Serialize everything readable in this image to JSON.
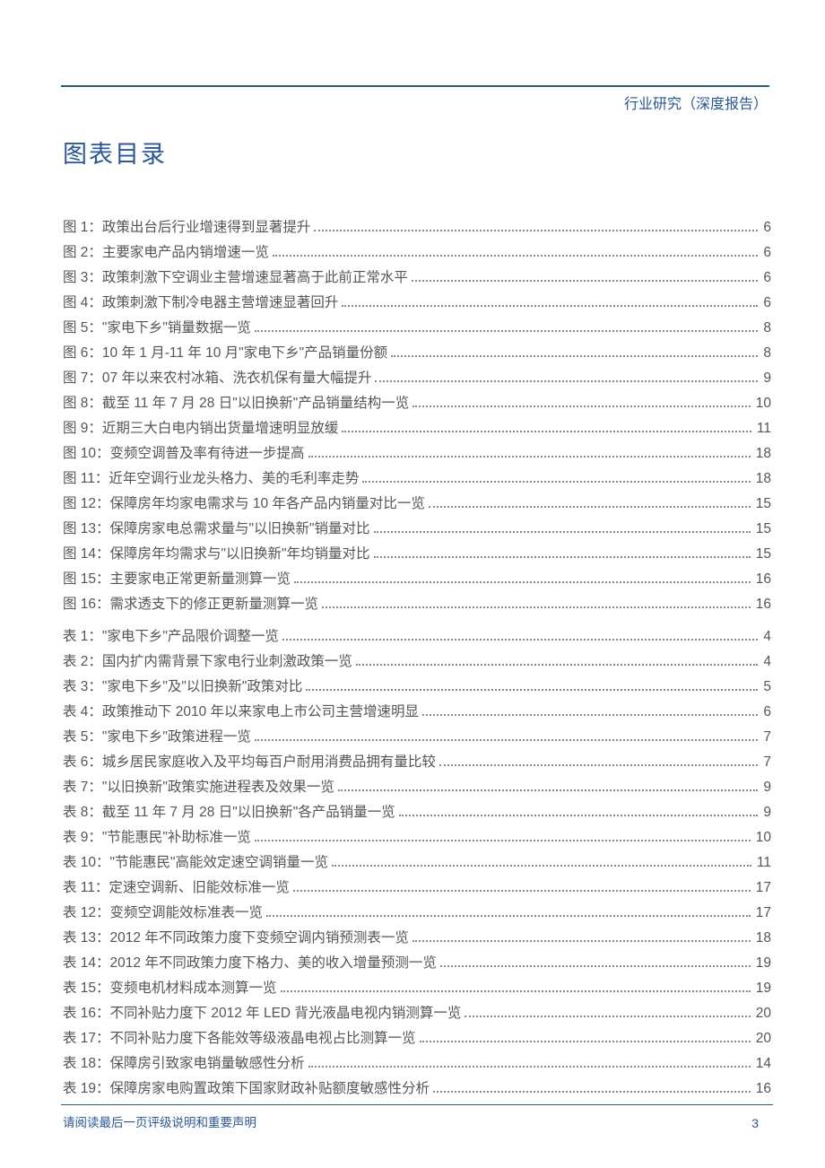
{
  "header": {
    "category": "行业研究（深度报告）"
  },
  "title": "图表目录",
  "figures": [
    {
      "label": "图 1：政策出台后行业增速得到显著提升",
      "page": "6"
    },
    {
      "label": "图 2：主要家电产品内销增速一览",
      "page": "6"
    },
    {
      "label": "图 3：政策刺激下空调业主营增速显著高于此前正常水平",
      "page": "6"
    },
    {
      "label": "图 4：政策刺激下制冷电器主营增速显著回升",
      "page": "6"
    },
    {
      "label": "图 5：\"家电下乡\"销量数据一览",
      "page": "8"
    },
    {
      "label": "图 6：10 年 1 月-11 年 10 月\"家电下乡\"产品销量份额",
      "page": "8"
    },
    {
      "label": "图 7：07 年以来农村冰箱、洗衣机保有量大幅提升",
      "page": "9"
    },
    {
      "label": "图 8：截至 11 年 7 月 28 日\"以旧换新\"产品销量结构一览",
      "page": "10"
    },
    {
      "label": "图 9：近期三大白电内销出货量增速明显放缓",
      "page": "11"
    },
    {
      "label": "图 10：变频空调普及率有待进一步提高",
      "page": "18"
    },
    {
      "label": "图 11：近年空调行业龙头格力、美的毛利率走势",
      "page": "18"
    },
    {
      "label": "图 12：保障房年均家电需求与 10 年各产品内销量对比一览",
      "page": "15"
    },
    {
      "label": "图 13：保障房家电总需求量与\"以旧换新\"销量对比",
      "page": "15"
    },
    {
      "label": "图 14：保障房年均需求与\"以旧换新\"年均销量对比",
      "page": "15"
    },
    {
      "label": "图 15：主要家电正常更新量测算一览",
      "page": "16"
    },
    {
      "label": "图 16：需求透支下的修正更新量测算一览",
      "page": "16"
    }
  ],
  "tables": [
    {
      "label": "表 1：\"家电下乡\"产品限价调整一览",
      "page": "4"
    },
    {
      "label": "表 2：国内扩内需背景下家电行业刺激政策一览",
      "page": "4"
    },
    {
      "label": "表 3：\"家电下乡\"及\"以旧换新\"政策对比",
      "page": "5"
    },
    {
      "label": "表 4：政策推动下 2010 年以来家电上市公司主营增速明显",
      "page": "6"
    },
    {
      "label": "表 5：\"家电下乡\"政策进程一览",
      "page": "7"
    },
    {
      "label": "表 6：城乡居民家庭收入及平均每百户耐用消费品拥有量比较",
      "page": "7"
    },
    {
      "label": "表 7：\"以旧换新\"政策实施进程表及效果一览",
      "page": "9"
    },
    {
      "label": "表 8：截至 11 年 7 月 28 日\"以旧换新\"各产品销量一览",
      "page": "9"
    },
    {
      "label": "表 9：\"节能惠民\"补助标准一览",
      "page": "10"
    },
    {
      "label": "表 10：\"节能惠民\"高能效定速空调销量一览",
      "page": "11"
    },
    {
      "label": "表 11：定速空调新、旧能效标准一览",
      "page": "17"
    },
    {
      "label": "表 12：变频空调能效标准表一览",
      "page": "17"
    },
    {
      "label": "表 13：2012 年不同政策力度下变频空调内销预测表一览",
      "page": "18"
    },
    {
      "label": "表 14：2012 年不同政策力度下格力、美的收入增量预测一览",
      "page": "19"
    },
    {
      "label": "表 15：变频电机材料成本测算一览",
      "page": "19"
    },
    {
      "label": "表 16：不同补贴力度下 2012 年 LED 背光液晶电视内销测算一览",
      "page": "20"
    },
    {
      "label": "表 17：不同补贴力度下各能效等级液晶电视占比测算一览",
      "page": "20"
    },
    {
      "label": "表 18：保障房引致家电销量敏感性分析",
      "page": "14"
    },
    {
      "label": "表 19：保障房家电购置政策下国家财政补贴额度敏感性分析",
      "page": "16"
    }
  ],
  "footer": {
    "note": "请阅读最后一页评级说明和重要声明",
    "page_number": "3"
  }
}
